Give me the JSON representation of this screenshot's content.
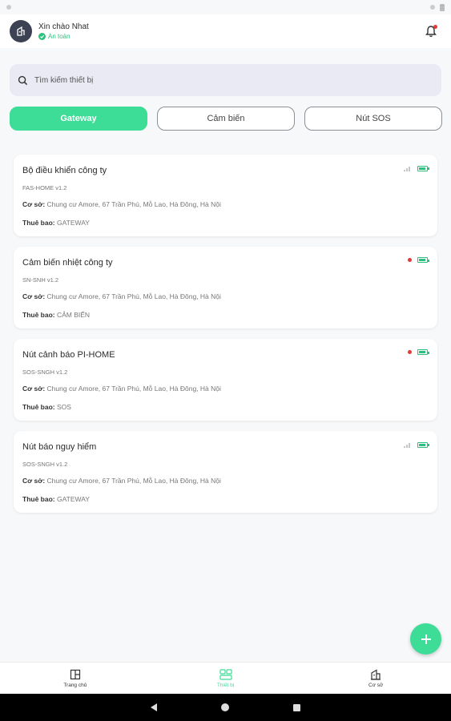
{
  "header": {
    "greeting": "Xin chào Nhat",
    "status": "An toàn"
  },
  "search": {
    "placeholder": "Tìm kiếm thiết bị"
  },
  "tabs": [
    {
      "label": "Gateway",
      "active": true
    },
    {
      "label": "Cảm biến",
      "active": false
    },
    {
      "label": "Nút SOS",
      "active": false
    }
  ],
  "devices": [
    {
      "name": "Bộ điều khiển công ty",
      "model": "FAS-HOME v1.2",
      "facility_label": "Cơ sở:",
      "facility": "Chung cư Amore, 67 Trần Phú, Mỗ Lao, Hà Đông, Hà Nội",
      "subscriber_label": "Thuê bao:",
      "subscriber": "GATEWAY",
      "indicator": "signal-icon"
    },
    {
      "name": "Cảm biến nhiệt công ty",
      "model": "SN-SNH v1.2",
      "facility_label": "Cơ sở:",
      "facility": "Chung cư Amore, 67 Trần Phú, Mỗ Lao, Hà Đông, Hà Nội",
      "subscriber_label": "Thuê bao:",
      "subscriber": "CẢM BIẾN",
      "indicator": "red-dot-icon"
    },
    {
      "name": "Nút cảnh báo PI-HOME",
      "model": "SOS-SNGH v1.2",
      "facility_label": "Cơ sở:",
      "facility": "Chung cư Amore, 67 Trần Phú, Mỗ Lao, Hà Đông, Hà Nội",
      "subscriber_label": "Thuê bao:",
      "subscriber": "SOS",
      "indicator": "red-dot-icon"
    },
    {
      "name": "Nút báo nguy hiểm",
      "model": "SOS-SNGH v1.2",
      "facility_label": "Cơ sở:",
      "facility": "Chung cư Amore, 67 Trần Phú, Mỗ Lao, Hà Đông, Hà Nội",
      "subscriber_label": "Thuê bao:",
      "subscriber": "GATEWAY",
      "indicator": "signal-icon"
    }
  ],
  "bottom_nav": [
    {
      "label": "Trang chủ",
      "icon": "home-icon",
      "active": false
    },
    {
      "label": "Thiết bị",
      "icon": "devices-icon",
      "active": true
    },
    {
      "label": "Cơ sở",
      "icon": "building-icon",
      "active": false
    }
  ],
  "colors": {
    "accent": "#3ddc97",
    "safe": "#2fbf7e",
    "alert": "#e53935",
    "avatar": "#3c4253"
  }
}
